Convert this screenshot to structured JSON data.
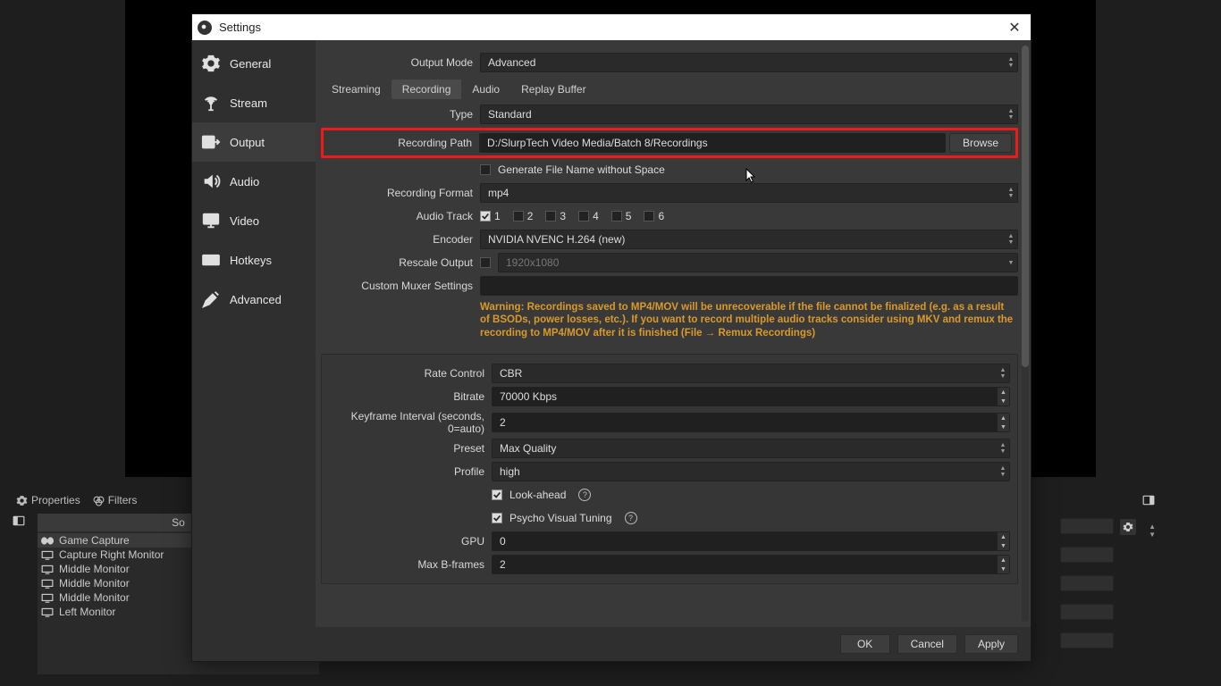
{
  "window": {
    "title": "Settings"
  },
  "nav": {
    "general": "General",
    "stream": "Stream",
    "output": "Output",
    "audio": "Audio",
    "video": "Video",
    "hotkeys": "Hotkeys",
    "advanced": "Advanced"
  },
  "tabs": {
    "streaming": "Streaming",
    "recording": "Recording",
    "audio": "Audio",
    "replay": "Replay Buffer"
  },
  "labels": {
    "output_mode": "Output Mode",
    "type": "Type",
    "recording_path": "Recording Path",
    "gen_no_space": "Generate File Name without Space",
    "recording_format": "Recording Format",
    "audio_track": "Audio Track",
    "encoder": "Encoder",
    "rescale_output": "Rescale Output",
    "custom_muxer": "Custom Muxer Settings",
    "rate_control": "Rate Control",
    "bitrate": "Bitrate",
    "keyframe": "Keyframe Interval (seconds, 0=auto)",
    "preset": "Preset",
    "profile": "Profile",
    "look_ahead": "Look-ahead",
    "psycho": "Psycho Visual Tuning",
    "gpu": "GPU",
    "max_bframes": "Max B-frames"
  },
  "values": {
    "output_mode": "Advanced",
    "type": "Standard",
    "recording_path": "D:/SlurpTech Video Media/Batch 8/Recordings",
    "browse": "Browse",
    "recording_format": "mp4",
    "tracks": [
      "1",
      "2",
      "3",
      "4",
      "5",
      "6"
    ],
    "encoder": "NVIDIA NVENC H.264 (new)",
    "rescale": "1920x1080",
    "custom_muxer": "",
    "rate_control": "CBR",
    "bitrate": "70000 Kbps",
    "keyframe": "2",
    "preset": "Max Quality",
    "profile": "high",
    "gpu": "0",
    "max_bframes": "2"
  },
  "warning_text": "Warning: Recordings saved to MP4/MOV will be unrecoverable if the file cannot be finalized (e.g. as a result of BSODs, power losses, etc.). If you want to record multiple audio tracks consider using MKV and remux the recording to MP4/MOV after it is finished (File → Remux Recordings)",
  "footer": {
    "ok": "OK",
    "cancel": "Cancel",
    "apply": "Apply"
  },
  "bg": {
    "properties": "Properties",
    "filters": "Filters",
    "sources_header": "So",
    "sources": [
      {
        "label": "Game Capture",
        "icon": "game"
      },
      {
        "label": "Capture Right Monitor",
        "icon": "monitor"
      },
      {
        "label": "Middle Monitor",
        "icon": "monitor"
      },
      {
        "label": "Middle Monitor",
        "icon": "monitor"
      },
      {
        "label": "Middle Monitor",
        "icon": "monitor"
      },
      {
        "label": "Left Monitor",
        "icon": "monitor"
      }
    ]
  }
}
